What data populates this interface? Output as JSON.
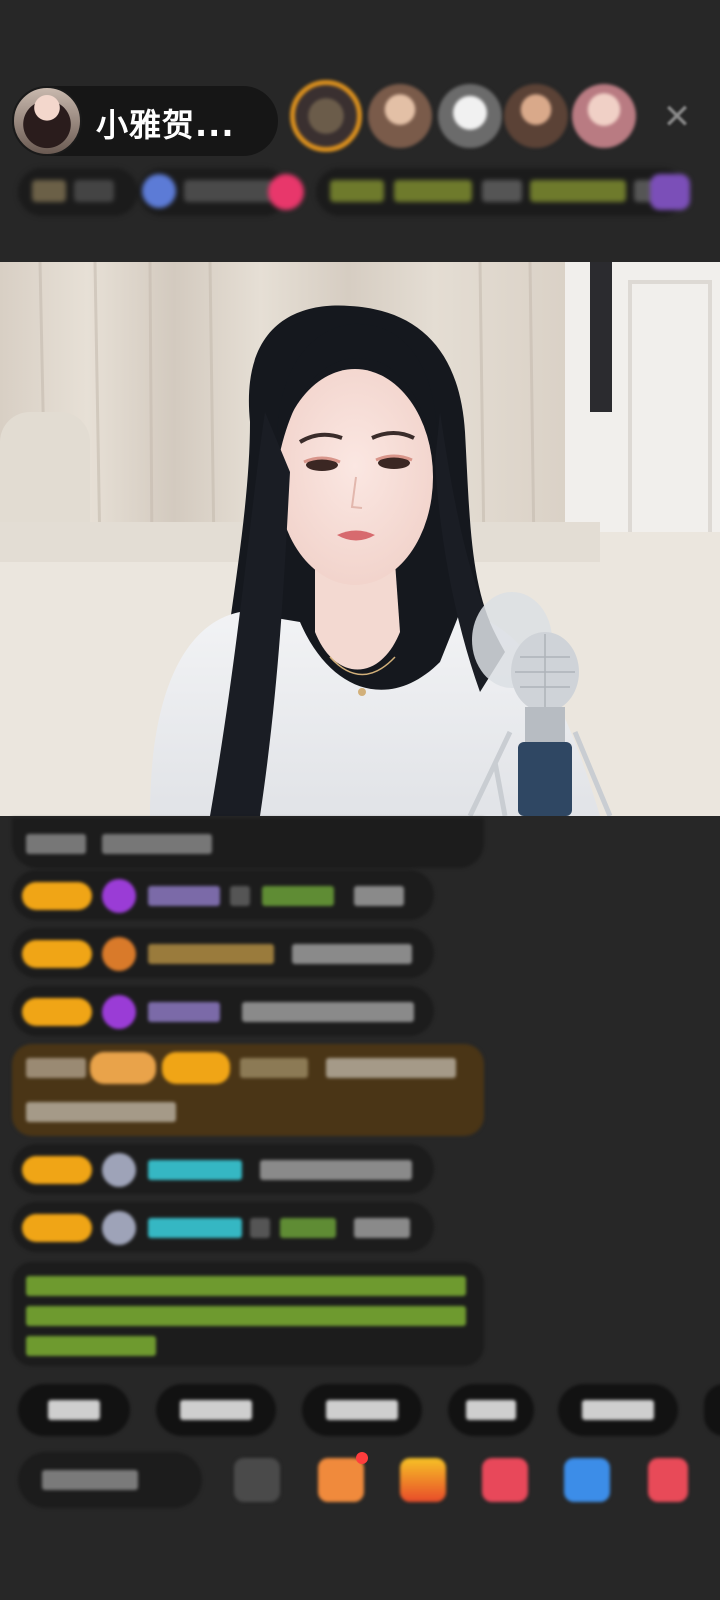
{
  "host": {
    "name": "小雅贺..."
  },
  "top_bar": {
    "close_icon": "close-icon",
    "viewer_avatars": 5
  },
  "colors": {
    "background": "#272727",
    "pill": "#161616",
    "gold_badge": "#f0a516",
    "highlight_row": "#4a3516",
    "green_text": "#8fc43b",
    "cyan_text": "#35b7c3",
    "purple_icon": "#9a3cd6"
  },
  "chat": {
    "messages": 9,
    "highlighted_message_index": 4
  },
  "bottom_bar": {
    "quick_buttons": 6,
    "icons": [
      "gift-box-icon",
      "treasure-icon",
      "red-packet-icon",
      "game-icon",
      "more-icon"
    ]
  }
}
